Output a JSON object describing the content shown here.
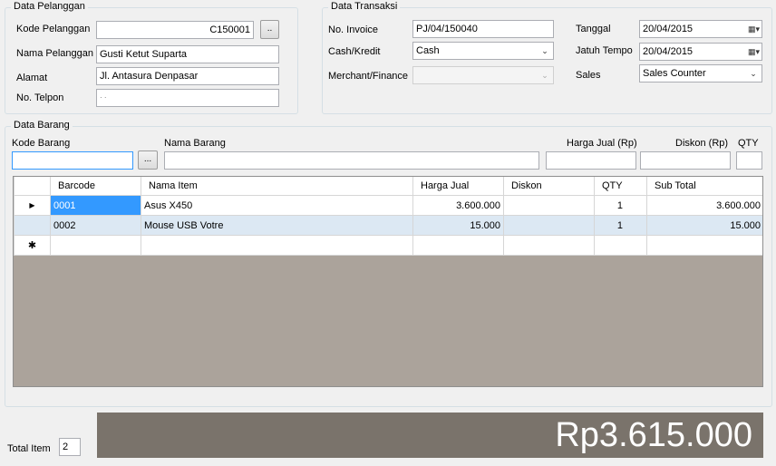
{
  "pelanggan": {
    "legend": "Data Pelanggan",
    "kode_label": "Kode Pelanggan",
    "kode_value": "C150001",
    "kode_btn": "..",
    "nama_label": "Nama Pelanggan",
    "nama_value": "Gusti Ketut Suparta",
    "alamat_label": "Alamat",
    "alamat_value": "Jl. Antasura Denpasar",
    "telpon_label": "No. Telpon",
    "telpon_value": "·        ·"
  },
  "transaksi": {
    "legend": "Data Transaksi",
    "invoice_label": "No. Invoice",
    "invoice_value": "PJ/04/150040",
    "cash_label": "Cash/Kredit",
    "cash_value": "Cash",
    "merchant_label": "Merchant/Finance",
    "merchant_value": "",
    "tanggal_label": "Tanggal",
    "tanggal_value": "20/04/2015",
    "jatuh_label": "Jatuh Tempo",
    "jatuh_value": "20/04/2015",
    "sales_label": "Sales",
    "sales_value": "Sales Counter"
  },
  "barang": {
    "legend": "Data Barang",
    "kode_label": "Kode Barang",
    "kode_btn": "...",
    "nama_label": "Nama Barang",
    "harga_label": "Harga Jual (Rp)",
    "diskon_label": "Diskon (Rp)",
    "qty_label": "QTY"
  },
  "grid": {
    "columns": [
      "Barcode",
      "Nama Item",
      "Harga Jual",
      "Diskon",
      "QTY",
      "Sub Total"
    ],
    "rows": [
      {
        "barcode": "0001",
        "nama": "Asus X450",
        "harga": "3.600.000",
        "diskon": "",
        "qty": "1",
        "subtotal": "3.600.000"
      },
      {
        "barcode": "0002",
        "nama": "Mouse USB Votre",
        "harga": "15.000",
        "diskon": "",
        "qty": "1",
        "subtotal": "15.000"
      }
    ],
    "current_row_glyph": "▶",
    "new_row_glyph": "✱"
  },
  "footer": {
    "total_item_label": "Total Item",
    "total_item_value": "2",
    "grand_total": "Rp3.615.000"
  },
  "colors": {
    "total_panel_bg": "#7a736b",
    "selected_cell_bg": "#3399ff",
    "alt_row_bg": "#dce8f3",
    "grid_empty_bg": "#aba39b"
  }
}
